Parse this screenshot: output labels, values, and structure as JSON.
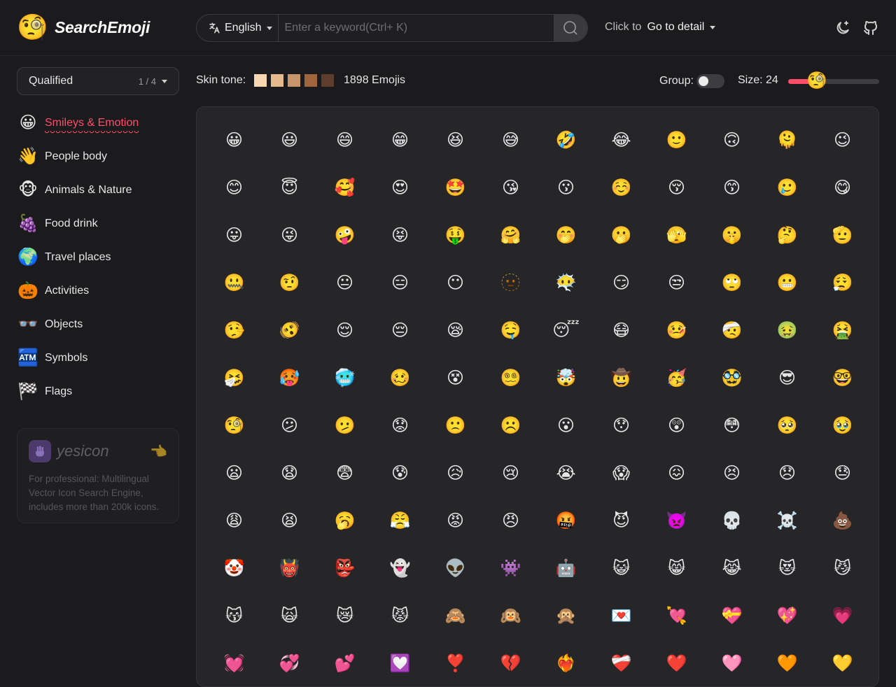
{
  "header": {
    "app_name": "SearchEmoji",
    "logo_emoji": "🧐",
    "language": {
      "icon": "translate-icon",
      "label": "English"
    },
    "search": {
      "placeholder": "Enter a keyword(Ctrl+ K)",
      "value": ""
    },
    "click_to_label": "Click to",
    "detail_label": "Go to detail",
    "icons": [
      "theme-toggle-icon",
      "github-icon"
    ]
  },
  "sidebar": {
    "qualified": {
      "label": "Qualified",
      "page": "1 / 4"
    },
    "categories": [
      {
        "emoji": "😀",
        "label": "Smileys & Emotion",
        "active": true
      },
      {
        "emoji": "👋",
        "label": "People body"
      },
      {
        "emoji": "🐵",
        "label": "Animals & Nature"
      },
      {
        "emoji": "🍇",
        "label": "Food drink"
      },
      {
        "emoji": "🌍",
        "label": "Travel places"
      },
      {
        "emoji": "🎃",
        "label": "Activities"
      },
      {
        "emoji": "👓",
        "label": "Objects"
      },
      {
        "emoji": "🏧",
        "label": "Symbols"
      },
      {
        "emoji": "🏁",
        "label": "Flags"
      }
    ],
    "promo": {
      "name": "yesicon",
      "hand": "👈",
      "description": "For professional: Multilingual Vector Icon Search Engine, includes more than 200k icons."
    }
  },
  "toolbar": {
    "skin_tone_label": "Skin tone:",
    "skin_tones": [
      "#f7d7b0",
      "#e3b98d",
      "#c8956a",
      "#a0653c",
      "#5c3d2e"
    ],
    "emoji_count": "1898 Emojis",
    "group_label": "Group:",
    "group_enabled": false,
    "size_label": "Size: 24",
    "size_value": 24,
    "size_fill_fraction": 0.31,
    "slider_thumb_emoji": "🧐"
  },
  "emojis": [
    "😀",
    "😃",
    "😄",
    "😁",
    "😆",
    "😅",
    "🤣",
    "😂",
    "🙂",
    "🙃",
    "🫠",
    "😉",
    "😊",
    "😇",
    "🥰",
    "😍",
    "🤩",
    "😘",
    "😗",
    "☺️",
    "😚",
    "😙",
    "🥲",
    "😋",
    "😛",
    "😜",
    "🤪",
    "😝",
    "🤑",
    "🤗",
    "🤭",
    "🫢",
    "🫣",
    "🤫",
    "🤔",
    "🫡",
    "🤐",
    "🤨",
    "😐",
    "😑",
    "😶",
    "🫥",
    "😶‍🌫️",
    "😏",
    "😒",
    "🙄",
    "😬",
    "😮‍💨",
    "🤥",
    "🫨",
    "😌",
    "😔",
    "😪",
    "🤤",
    "😴",
    "😷",
    "🤒",
    "🤕",
    "🤢",
    "🤮",
    "🤧",
    "🥵",
    "🥶",
    "🥴",
    "😵",
    "😵‍💫",
    "🤯",
    "🤠",
    "🥳",
    "🥸",
    "😎",
    "🤓",
    "🧐",
    "😕",
    "🫤",
    "😟",
    "🙁",
    "☹️",
    "😮",
    "😯",
    "😲",
    "😳",
    "🥺",
    "🥹",
    "😦",
    "😧",
    "😨",
    "😰",
    "😥",
    "😢",
    "😭",
    "😱",
    "😖",
    "😣",
    "😞",
    "😓",
    "😩",
    "😫",
    "🥱",
    "😤",
    "😡",
    "😠",
    "🤬",
    "😈",
    "👿",
    "💀",
    "☠️",
    "💩",
    "🤡",
    "👹",
    "👺",
    "👻",
    "👽",
    "👾",
    "🤖",
    "😺",
    "😸",
    "😹",
    "😻",
    "😼",
    "😽",
    "🙀",
    "😿",
    "😾",
    "🙈",
    "🙉",
    "🙊",
    "💌",
    "💘",
    "💝",
    "💖",
    "💗",
    "💓",
    "💞",
    "💕",
    "💟",
    "❣️",
    "💔",
    "❤️‍🔥",
    "❤️‍🩹",
    "❤️",
    "🩷",
    "🧡",
    "💛"
  ]
}
